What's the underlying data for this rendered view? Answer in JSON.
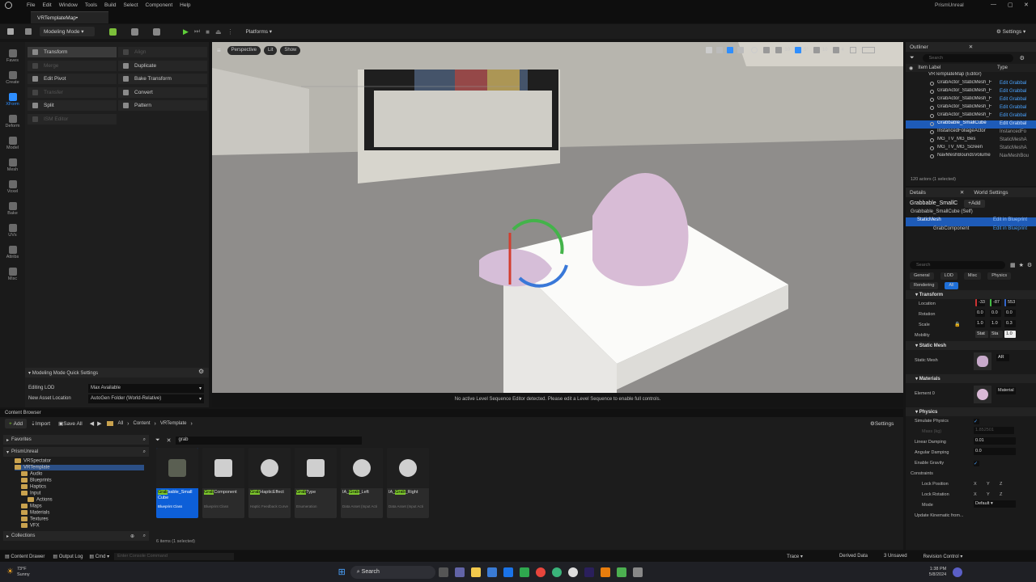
{
  "menu": [
    "File",
    "Edit",
    "Window",
    "Tools",
    "Build",
    "Select",
    "Component",
    "Help"
  ],
  "project_name": "PrismUnreal",
  "tab_title": "VRTemplateMap•",
  "toolbar": {
    "mode": "Modeling Mode",
    "platforms": "Platforms",
    "settings": "Settings"
  },
  "left_modes": [
    "Faves",
    "Create",
    "XForm",
    "Deform",
    "Model",
    "Mesh",
    "Voxel",
    "Bake",
    "UVs",
    "Attribs",
    "Misc"
  ],
  "tools": {
    "transform": "Transform",
    "align": "Align",
    "merge": "Merge",
    "duplicate": "Duplicate",
    "edit_pivot": "Edit Pivot",
    "bake_transform": "Bake Transform",
    "transfer": "Transfer",
    "convert": "Convert",
    "split": "Split",
    "pattern": "Pattern",
    "ism_editor": "ISM Editor"
  },
  "quick_settings": {
    "title": "Modeling Mode Quick Settings",
    "editing_lod_label": "Editing LOD",
    "editing_lod_value": "Max Available",
    "new_asset_label": "New Asset Location",
    "new_asset_value": "AutoGen Folder (World-Relative)"
  },
  "viewport": {
    "perspective": "Perspective",
    "lit": "Lit",
    "show": "Show",
    "grid_snap": "10",
    "rot_snap": "5°",
    "scale_snap": "10",
    "cam_speed": "4",
    "message": "No active Level Sequence Editor detected. Please edit a Level Sequence to enable full controls."
  },
  "outliner": {
    "title": "Outliner",
    "search_placeholder": "Search",
    "col_label": "Item Label",
    "col_type": "Type",
    "map": "VRTemplateMap (Editor)",
    "rows": [
      {
        "label": "GrabActor_StaticMesh_F",
        "type": "Edit Grabbal"
      },
      {
        "label": "GrabActor_StaticMesh_F",
        "type": "Edit Grabbal"
      },
      {
        "label": "GrabActor_StaticMesh_F",
        "type": "Edit Grabbal"
      },
      {
        "label": "GrabActor_StaticMesh_F",
        "type": "Edit Grabbal"
      },
      {
        "label": "GrabActor_StaticMesh_F",
        "type": "Edit Grabbal"
      },
      {
        "label": "Grabbable_SmallCube",
        "type": "Edit Grabbal"
      },
      {
        "label": "InstancedFoliageActor",
        "type": "InstancedFo"
      },
      {
        "label": "MG_TV_MG_Bes",
        "type": "StaticMeshA"
      },
      {
        "label": "MG_TV_MG_Screen",
        "type": "StaticMeshA"
      },
      {
        "label": "NavMeshBoundsVolume",
        "type": "NavMeshBou"
      }
    ],
    "footer": "120 actors (1 selected)"
  },
  "details": {
    "tab1": "Details",
    "tab2": "World Settings",
    "actor": "Grabbable_SmallC",
    "add": "Add",
    "self": "Grabbable_SmallCube (Self)",
    "static_mesh": "StaticMesh",
    "grab": "GrabComponent",
    "edit_bp": "Edit in Blueprint",
    "search_placeholder": "Search",
    "filters": [
      "General",
      "LOD",
      "Misc",
      "Physics",
      "Rendering",
      "All"
    ],
    "transform": "Transform",
    "location": "Location",
    "rotation": "Rotation",
    "scale": "Scale",
    "mobility": "Mobility",
    "loc": [
      "-33",
      "-87",
      "553"
    ],
    "rot": [
      "0.0",
      "0.0",
      "0.0"
    ],
    "scl": [
      "1.0",
      "1.0",
      "0.3"
    ],
    "mob": [
      "Stat",
      "Sta"
    ],
    "tooltip": "1.0",
    "sm_section": "Static Mesh",
    "sm_label": "Static Mesh",
    "sm_val": "AR",
    "mat_section": "Materials",
    "mat_label": "Element 0",
    "mat_val": "Material",
    "phys_section": "Physics",
    "sim": "Simulate Physics",
    "mass": "Mass (kg)",
    "mass_val": "1.852501",
    "lin": "Linear Damping",
    "lin_val": "0.01",
    "ang": "Angular Damping",
    "ang_val": "0.0",
    "grav": "Enable Gravity",
    "constraints": "Constraints",
    "lockpos": "Lock Position",
    "lockrot": "Lock Rotation",
    "mode": "Mode",
    "mode_val": "Default",
    "xyz": [
      "X",
      "Y",
      "Z"
    ],
    "kin": "Update Kinematic from..."
  },
  "content": {
    "title": "Content Browser",
    "add": "Add",
    "import": "Import",
    "saveall": "Save All",
    "crumbs": [
      "All",
      "Content",
      "VRTemplate"
    ],
    "settings": "Settings",
    "favorites": "Favorites",
    "project": "PrismUnreal",
    "search": "grab",
    "items_count": "6 items (1 selected)",
    "collections": "Collections",
    "tree": [
      "VRSpectator",
      "VRTemplate",
      "Audio",
      "Blueprints",
      "Haptics",
      "Input",
      "Actions",
      "Maps",
      "Materials",
      "Textures",
      "VFX"
    ],
    "assets": [
      {
        "pre": "Grab",
        "post": "bable_Small Cube",
        "cls": "Blueprint Class"
      },
      {
        "pre": "Grab",
        "post": "Component",
        "cls": "Blueprint Class"
      },
      {
        "pre": "Grab",
        "post": "HapticEffect",
        "cls": "Haptic Feedback Curve"
      },
      {
        "pre": "Grab",
        "post": "Type",
        "cls": "Enumeration"
      },
      {
        "pre": "IA_",
        "mid": "Grab",
        "post": "_Left",
        "cls": "Data Asset (Input Acti"
      },
      {
        "pre": "IA_",
        "mid": "Grab",
        "post": "_Right",
        "cls": "Data Asset (Input Acti"
      }
    ]
  },
  "status": {
    "drawer": "Content Drawer",
    "output": "Output Log",
    "cmd": "Cmd",
    "console_placeholder": "Enter Console Command",
    "trace": "Trace",
    "derived": "Derived Data",
    "unsaved": "3 Unsaved",
    "revision": "Revision Control"
  },
  "taskbar": {
    "temp": "73°F",
    "weather": "Sunny",
    "search": "Search",
    "time": "1:38 PM",
    "date": "5/8/2024"
  }
}
